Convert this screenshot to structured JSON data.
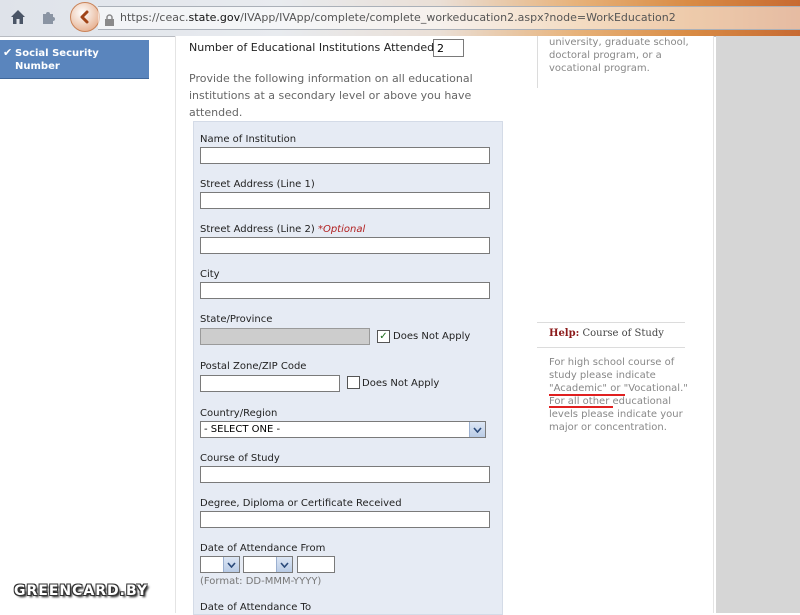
{
  "browser": {
    "url_prefix": "https://ceac.",
    "url_host": "state.gov",
    "url_path": "/IVApp/IVApp/complete/complete_workeducation2.aspx?node=WorkEducation2"
  },
  "sidebar": {
    "items": [
      {
        "label": "Social Security Number",
        "checked": true,
        "check_glyph": "✔"
      }
    ]
  },
  "form": {
    "num_institutions_label": "Number of Educational Institutions Attended:",
    "num_institutions_value": "2",
    "intro": "Provide the following information on all educational institutions at a secondary level or above you have attended.",
    "fields": {
      "name_label": "Name of Institution",
      "street1_label": "Street Address (Line 1)",
      "street2_label": "Street Address (Line 2)",
      "optional_tag": "*Optional",
      "city_label": "City",
      "state_label": "State/Province",
      "state_does_not_apply": "Does Not Apply",
      "postal_label": "Postal Zone/ZIP Code",
      "postal_does_not_apply": "Does Not Apply",
      "country_label": "Country/Region",
      "country_selected": "- SELECT ONE -",
      "course_label": "Course of Study",
      "degree_label": "Degree, Diploma or Certificate Received",
      "date_from_label": "Date of Attendance From",
      "date_format": "(Format: DD-MMM-YYYY)",
      "date_to_label": "Date of Attendance To"
    },
    "state_does_not_apply_checked": true,
    "postal_does_not_apply_checked": false
  },
  "help": {
    "top_text": "university, graduate school, doctoral program, or a vocational program.",
    "title_prefix": "Help:",
    "title": "Course of Study",
    "text_part1": "For high school course of study please indicate",
    "academic": "\"Academic\"",
    "or": " or ",
    "vocational": "\"Vocational.\"",
    "text_part2": " For all other educational levels please indicate your major or concentration.",
    "underline_color": "#e02020"
  },
  "watermark": "GREENCARD.BY"
}
